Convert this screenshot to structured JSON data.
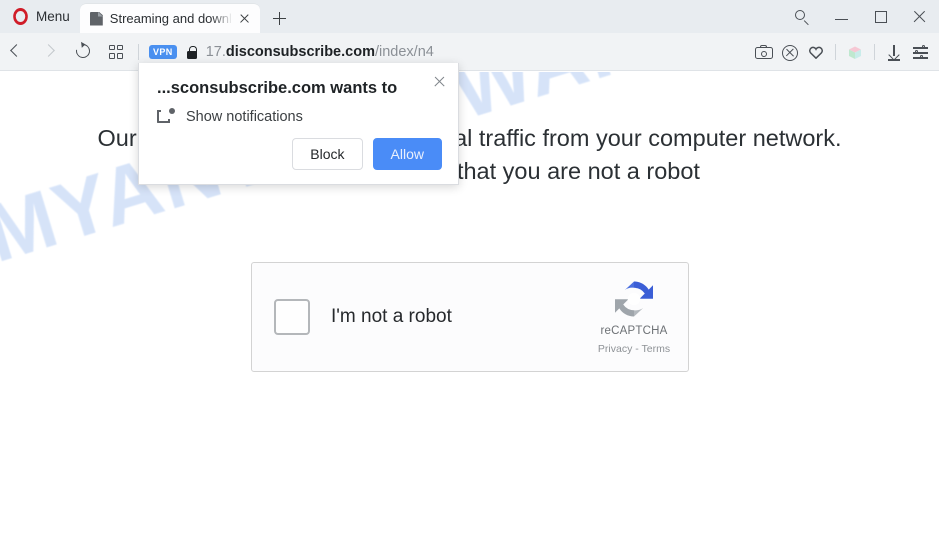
{
  "browser": {
    "menu_label": "Menu",
    "opera_logo_icon": "opera-logo-icon",
    "tab": {
      "title": "Streaming and downlo",
      "favicon": "page-icon",
      "close_icon": "close-icon"
    },
    "new_tab_icon": "plus-icon",
    "window_controls": {
      "search_icon": "search-icon",
      "minimize_icon": "minimize-icon",
      "maximize_icon": "maximize-icon",
      "close_icon": "close-icon"
    },
    "navigation": {
      "back_icon": "chevron-left-icon",
      "forward_icon": "chevron-right-icon",
      "reload_icon": "reload-icon",
      "speeddial_icon": "grid-icon"
    },
    "address": {
      "vpn_badge": "VPN",
      "lock_icon": "lock-icon",
      "url_prefix": "17.",
      "url_host": "disconsubscribe.com",
      "url_path": "/index/n4"
    },
    "toolbar_icons": [
      "camera-icon",
      "adblock-shield-icon",
      "heart-icon",
      "cube-icon",
      "download-icon",
      "settings-sliders-icon"
    ]
  },
  "page": {
    "watermark": "MYANTISPYWARE.COM",
    "headline_line1": "Our systems have detected unusual traffic from your computer network.",
    "headline_line2": "Click 'Allow' to verify that you are not a robot",
    "recaptcha": {
      "checkbox_icon": "checkbox-unchecked-icon",
      "label": "I'm not a robot",
      "logo_icon": "recaptcha-logo-icon",
      "brand": "reCAPTCHA",
      "links": "Privacy - Terms"
    }
  },
  "notification_popup": {
    "title": "...sconsubscribe.com wants to",
    "close_icon": "close-icon",
    "permission_icon": "notification-icon",
    "permission_label": "Show notifications",
    "block_label": "Block",
    "allow_label": "Allow"
  },
  "colors": {
    "accent_blue": "#4a8cf7",
    "opera_red": "#d01c28",
    "vpn_blue": "#4a90f0",
    "watermark_blue": "#cbdcf7",
    "recaptcha_blue": "#3b5ed6",
    "recaptcha_gray": "#9fa5ab"
  }
}
